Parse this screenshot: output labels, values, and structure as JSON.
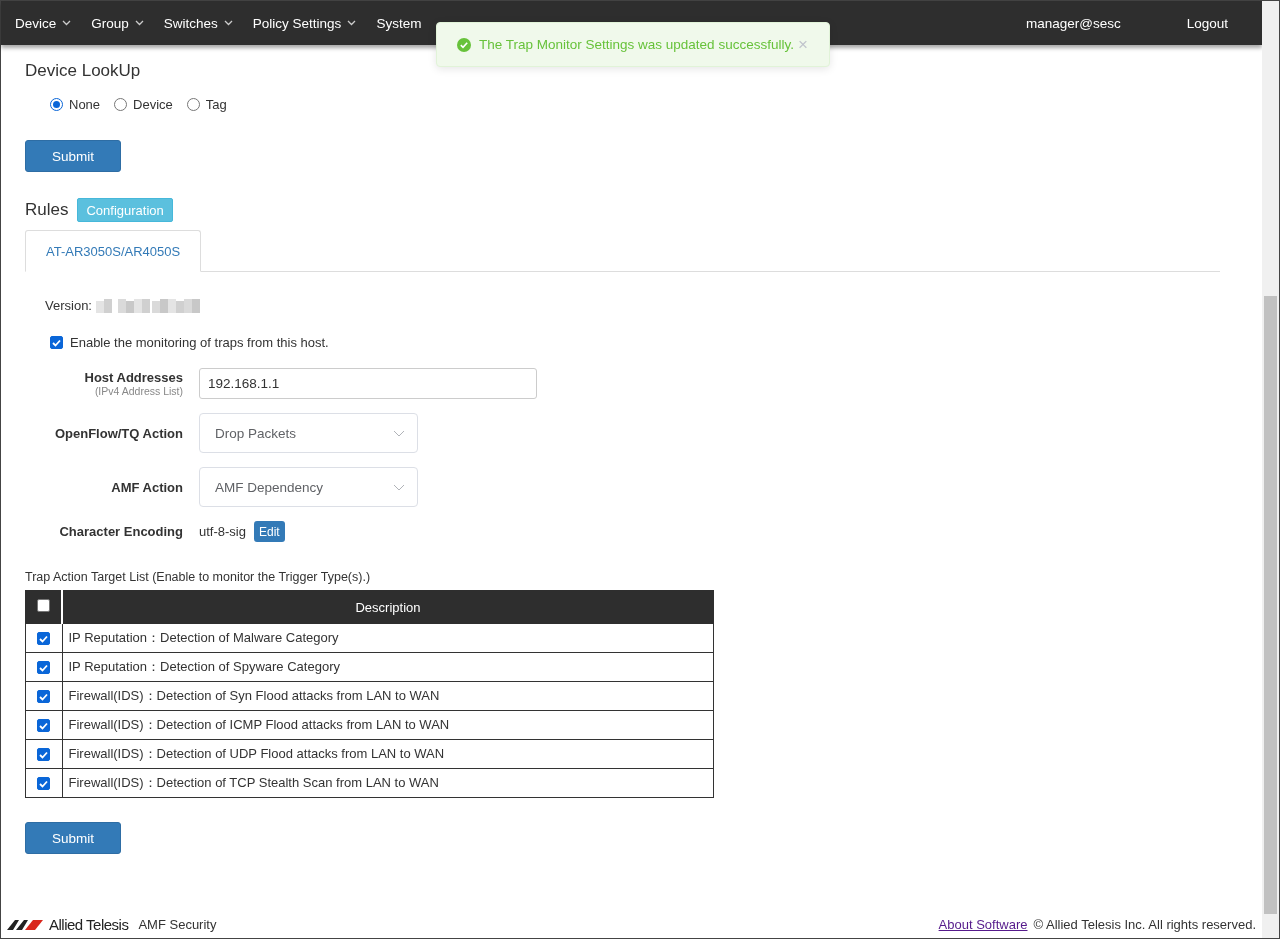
{
  "nav": {
    "items": [
      {
        "label": "Device",
        "caret": true
      },
      {
        "label": "Group",
        "caret": true
      },
      {
        "label": "Switches",
        "caret": true
      },
      {
        "label": "Policy Settings",
        "caret": true
      },
      {
        "label": "System",
        "caret": false
      }
    ],
    "user": "manager@sesc",
    "logout": "Logout"
  },
  "toast": {
    "message": "The Trap Monitor Settings was updated successfully.",
    "close": "×"
  },
  "lookup": {
    "title": "Device LookUp",
    "options": [
      {
        "label": "None",
        "selected": true
      },
      {
        "label": "Device",
        "selected": false
      },
      {
        "label": "Tag",
        "selected": false
      }
    ],
    "submit": "Submit"
  },
  "rules": {
    "title": "Rules",
    "config_button": "Configuration",
    "tabs": [
      {
        "label": "AT-AR3050S/AR4050S",
        "selected": true
      }
    ]
  },
  "form": {
    "version_label": "Version:",
    "enable": {
      "label": "Enable the monitoring of traps from this host.",
      "checked": true
    },
    "host": {
      "label": "Host Addresses",
      "hint": "(IPv4 Address List)",
      "value": "192.168.1.1"
    },
    "openflow": {
      "label": "OpenFlow/TQ Action",
      "value": "Drop Packets"
    },
    "amf": {
      "label": "AMF Action",
      "value": "AMF Dependency"
    },
    "encoding": {
      "label": "Character Encoding",
      "value": "utf-8-sig",
      "edit": "Edit"
    }
  },
  "table": {
    "caption": "Trap Action Target List (Enable to monitor the Trigger Type(s).)",
    "header_checked": false,
    "column": "Description",
    "rows": [
      {
        "text": "IP Reputation：Detection of Malware Category",
        "checked": true
      },
      {
        "text": "IP Reputation：Detection of Spyware Category",
        "checked": true
      },
      {
        "text": "Firewall(IDS)：Detection of Syn Flood attacks from LAN to WAN",
        "checked": true
      },
      {
        "text": "Firewall(IDS)：Detection of ICMP Flood attacks from LAN to WAN",
        "checked": true
      },
      {
        "text": "Firewall(IDS)：Detection of UDP Flood attacks from LAN to WAN",
        "checked": true
      },
      {
        "text": "Firewall(IDS)：Detection of TCP Stealth Scan from LAN to WAN",
        "checked": true
      }
    ]
  },
  "submit": "Submit",
  "footer": {
    "brand": "Allied Telesis",
    "product": "AMF Security",
    "about": "About Software",
    "copyright": "© Allied Telesis Inc. All rights reserved."
  }
}
